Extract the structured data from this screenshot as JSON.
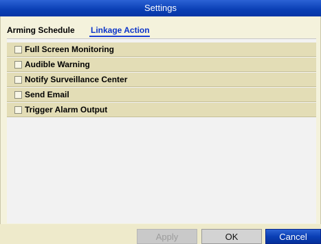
{
  "window": {
    "title": "Settings"
  },
  "tabs": [
    {
      "label": "Arming Schedule",
      "active": false
    },
    {
      "label": "Linkage Action",
      "active": true
    }
  ],
  "linkage_actions": [
    {
      "label": "Full Screen Monitoring",
      "checked": false
    },
    {
      "label": "Audible Warning",
      "checked": false
    },
    {
      "label": "Notify Surveillance Center",
      "checked": false
    },
    {
      "label": "Send Email",
      "checked": false
    },
    {
      "label": "Trigger Alarm Output",
      "checked": false
    }
  ],
  "buttons": {
    "apply": "Apply",
    "ok": "OK",
    "cancel": "Cancel"
  },
  "colors": {
    "title_bar": "#0a3fb5",
    "active_tab": "#0b34c9",
    "row_background": "#e3ddb6",
    "dialog_background": "#f4f2dc"
  }
}
